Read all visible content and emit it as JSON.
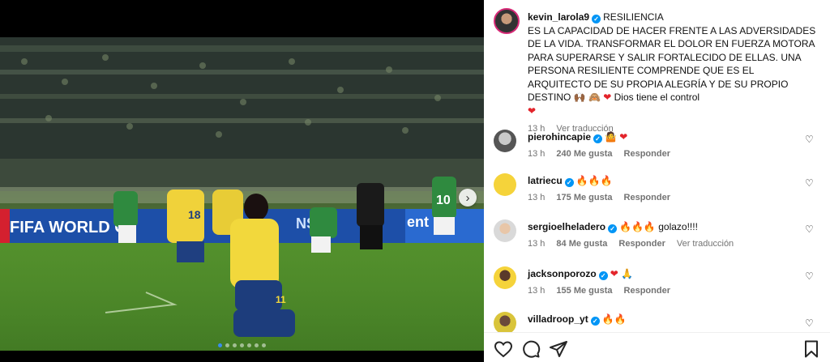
{
  "post": {
    "username": "kevin_larola9",
    "caption_title": "RESILIENCIA",
    "caption_body": "ES LA CAPACIDAD DE HACER FRENTE A LAS ADVERSIDADES DE LA VIDA. TRANSFORMAR EL DOLOR EN FUERZA MOTORA PARA SUPERARSE Y SALIR FORTALECIDO DE ELLAS. UNA PERSONA RESILIENTE COMPRENDE QUE ES EL ARQUITECTO DE SU PROPIA ALEGRÍA Y DE SU PROPIO DESTINO",
    "caption_tail": "Dios tiene el control",
    "time": "13 h",
    "translate": "Ver traducción"
  },
  "media": {
    "banner_text": "FIFA WORLD C",
    "banner_text_2": "NS",
    "banner_text_3": "ent",
    "player_number": "11",
    "player_number_2": "18",
    "player_number_3": "10",
    "carousel_pages": 7,
    "carousel_active": 0
  },
  "comments": [
    {
      "user": "pierohincapie",
      "text": "",
      "emojis": "🤷 ❤",
      "time": "13 h",
      "likes": "240 Me gusta",
      "reply": "Responder",
      "translate": ""
    },
    {
      "user": "latriecu",
      "text": "",
      "emojis": "🔥🔥🔥",
      "time": "13 h",
      "likes": "175 Me gusta",
      "reply": "Responder",
      "translate": ""
    },
    {
      "user": "sergioelheladero",
      "text": "golazo!!!!",
      "emojis": "🔥🔥🔥",
      "time": "13 h",
      "likes": "84 Me gusta",
      "reply": "Responder",
      "translate": "Ver traducción"
    },
    {
      "user": "jacksonporozo",
      "text": "",
      "emojis": "❤ 🙏",
      "time": "13 h",
      "likes": "155 Me gusta",
      "reply": "Responder",
      "translate": ""
    },
    {
      "user": "villadroop_yt",
      "text": "",
      "emojis": "🔥🔥",
      "time": "",
      "likes": "",
      "reply": "",
      "translate": ""
    }
  ],
  "colors": {
    "verified": "#0095f6",
    "heart": "#e3242b",
    "meta": "#737373"
  },
  "icons": [
    "heart-icon",
    "comment-icon",
    "share-icon",
    "bookmark-icon",
    "chevron-right-icon"
  ]
}
